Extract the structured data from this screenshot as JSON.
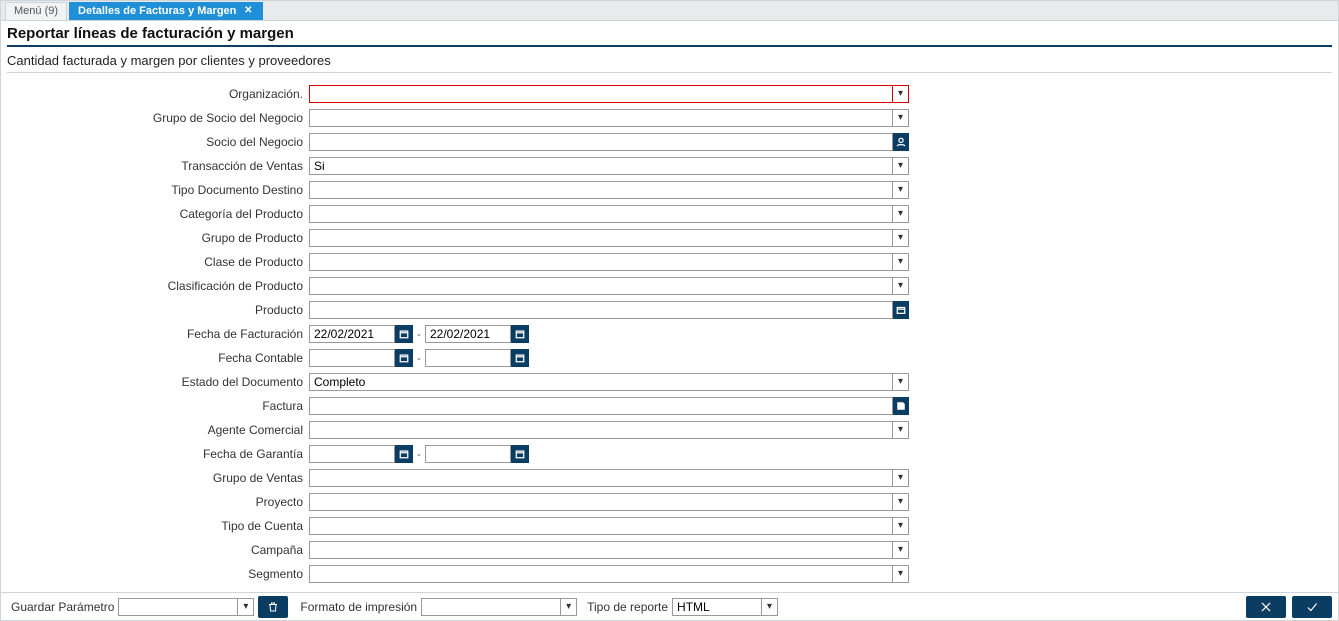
{
  "tabs": {
    "menu": "Menú (9)",
    "active": "Detalles de Facturas y Margen"
  },
  "page_title": "Reportar líneas de facturación y margen",
  "page_subtitle": "Cantidad facturada y margen por clientes y proveedores",
  "labels": {
    "organizacion": "Organización.",
    "grupo_socio": "Grupo de Socio del Negocio",
    "socio": "Socio del Negocio",
    "transaccion_ventas": "Transacción de Ventas",
    "tipo_doc_destino": "Tipo Documento Destino",
    "categoria_producto": "Categoría del Producto",
    "grupo_producto": "Grupo de Producto",
    "clase_producto": "Clase de Producto",
    "clasificacion_producto": "Clasificación de Producto",
    "producto": "Producto",
    "fecha_facturacion": "Fecha de Facturación",
    "fecha_contable": "Fecha Contable",
    "estado_documento": "Estado del Documento",
    "factura": "Factura",
    "agente_comercial": "Agente Comercial",
    "fecha_garantia": "Fecha de Garantía",
    "grupo_ventas": "Grupo de Ventas",
    "proyecto": "Proyecto",
    "tipo_cuenta": "Tipo de Cuenta",
    "campana": "Campaña",
    "segmento": "Segmento"
  },
  "values": {
    "organizacion": "",
    "grupo_socio": "",
    "socio": "",
    "transaccion_ventas": "Si",
    "tipo_doc_destino": "",
    "categoria_producto": "",
    "grupo_producto": "",
    "clase_producto": "",
    "clasificacion_producto": "",
    "producto": "",
    "fecha_facturacion_from": "22/02/2021",
    "fecha_facturacion_to": "22/02/2021",
    "fecha_contable_from": "",
    "fecha_contable_to": "",
    "estado_documento": "Completo",
    "factura": "",
    "agente_comercial": "",
    "fecha_garantia_from": "",
    "fecha_garantia_to": "",
    "grupo_ventas": "",
    "proyecto": "",
    "tipo_cuenta": "",
    "campana": "",
    "segmento": ""
  },
  "footer": {
    "guardar_param": "Guardar Parámetro",
    "guardar_param_value": "",
    "formato_impresion": "Formato de impresión",
    "formato_impresion_value": "",
    "tipo_reporte": "Tipo de reporte",
    "tipo_reporte_value": "HTML"
  }
}
